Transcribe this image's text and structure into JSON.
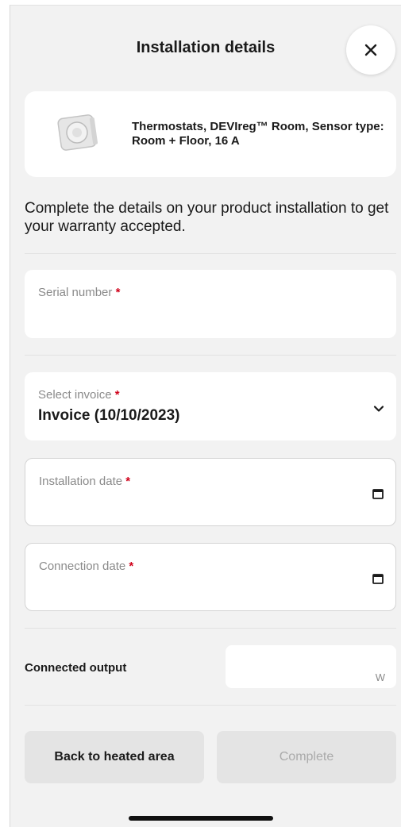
{
  "header": {
    "title": "Installation details",
    "close_icon": "close-icon"
  },
  "product": {
    "name": "Thermostats, DEVIreg™ Room, Sensor type: Room + Floor, 16 A",
    "image_icon": "thermostat-image"
  },
  "intro_text": "Complete the details on your product installation to get your warranty accepted.",
  "fields": {
    "serial_number": {
      "label": "Serial number",
      "required_mark": "*",
      "value": ""
    },
    "invoice": {
      "label": "Select invoice",
      "required_mark": "*",
      "value": "Invoice (10/10/2023)",
      "icon": "chevron-down-icon"
    },
    "installation_date": {
      "label": "Installation date",
      "required_mark": "*",
      "value": "",
      "icon": "calendar-icon"
    },
    "connection_date": {
      "label": "Connection date",
      "required_mark": "*",
      "value": "",
      "icon": "calendar-icon"
    }
  },
  "connected_output": {
    "label": "Connected output",
    "value": "",
    "unit": "W"
  },
  "buttons": {
    "back": "Back to heated area",
    "complete": "Complete"
  },
  "colors": {
    "background": "#f2f2f2",
    "card": "#ffffff",
    "required": "#d0021b",
    "button": "#e4e4e4",
    "disabled_text": "#aaaaaa"
  }
}
